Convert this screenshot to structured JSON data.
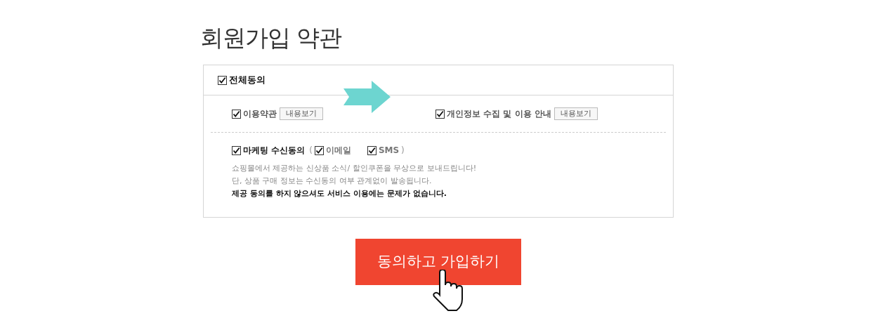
{
  "title": "회원가입 약관",
  "agree_all": {
    "label": "전체동의",
    "checked": true
  },
  "terms": [
    {
      "label": "이용약관",
      "checked": true,
      "button": "내용보기"
    },
    {
      "label": "개인정보 수집 및 이용 안내",
      "checked": true,
      "button": "내용보기"
    }
  ],
  "marketing": {
    "label": "마케팅 수신동의",
    "checked": true,
    "open_paren": "(",
    "close_paren": ")",
    "channels": [
      {
        "label": "이메일",
        "checked": true
      },
      {
        "label": "SMS",
        "checked": true
      }
    ],
    "notes": [
      {
        "text": "쇼핑몰에서 제공하는 신상품 소식/ 할인쿠폰을 무상으로 보내드립니다!",
        "emphasis": false
      },
      {
        "text": "단, 상품 구매 정보는 수신동의 여부 관계없이 발송됩니다.",
        "emphasis": false
      },
      {
        "text": "제공 동의를 하지 않으셔도 서비스 이용에는 문제가 없습니다.",
        "emphasis": true
      }
    ]
  },
  "submit_button": "동의하고 가입하기"
}
